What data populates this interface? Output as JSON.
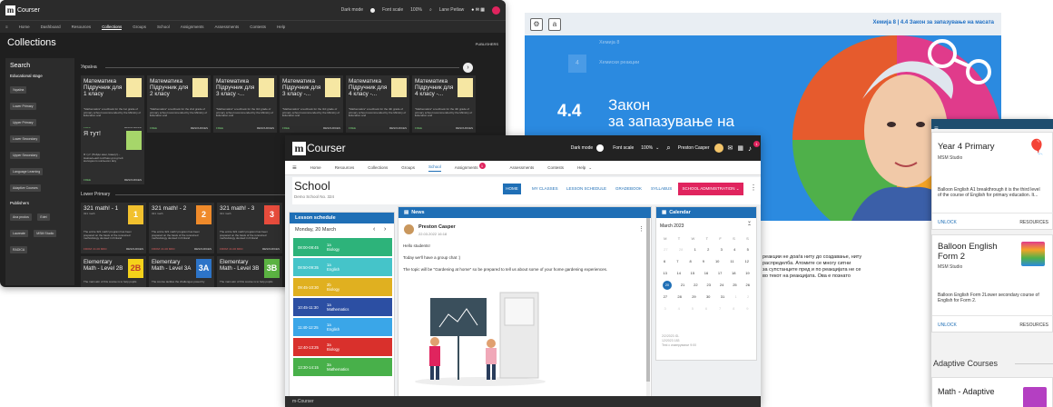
{
  "dark": {
    "brand": "Courser",
    "top_right": [
      "Dark mode",
      "Font scale",
      "100%",
      "Lane Petlaw"
    ],
    "nav": [
      "Home",
      "Dashboard",
      "Resources",
      "Collections",
      "Groups",
      "School",
      "Assignments",
      "Assessments",
      "Contests",
      "Help"
    ],
    "page_title": "Collections",
    "publishers_btn": "PUBLISHERS",
    "search_title": "Search",
    "edu_stage_label": "Educational stage",
    "edu_chips": [
      "Україна",
      "Lower Primary",
      "Upper Primary",
      "Lower Secondary",
      "Upper Secondary",
      "Language Learning",
      "Adaptive Courses"
    ],
    "publishers_label": "Publishers",
    "pub_chips": [
      "Ana prodos",
      "Edet",
      "Laureate",
      "MSM Studio",
      "RADICA"
    ],
    "section_ukraine": "Україна",
    "ukraine_cards": [
      {
        "title": "Математика Підручник для 1 класу",
        "desc": "\"Mathematics\" a textbook for the 1st grade of primary school recommended by the Ministry of Education and",
        "free": "FREE",
        "res": "RESOURCES"
      },
      {
        "title": "Математика Підручник для 2 класу",
        "desc": "\"Mathematics\" a textbook for the 2nd grade of primary school recommended by the Ministry of Education and",
        "free": "FREE",
        "res": "RESOURCES"
      },
      {
        "title": "Математика Підручник для 3 класу -...",
        "desc": "\"Mathematics\" a textbook for the 3rd grade of primary school recommended by the Ministry of Education and",
        "free": "FREE",
        "res": "RESOURCES"
      },
      {
        "title": "Математика Підручник для 3 класу -...",
        "desc": "\"Mathematics\" a textbook for the 3rd grade of primary school recommended by the Ministry of Education and",
        "free": "FREE",
        "res": "RESOURCES"
      },
      {
        "title": "Математика Підручник для 4 класу -...",
        "desc": "\"Mathematics\" a textbook for the 4th grade of primary school recommended by the Ministry of Education and",
        "free": "FREE",
        "res": "RESOURCES"
      },
      {
        "title": "Математика Підручник для 4 класу -...",
        "desc": "\"Mathematics\" a textbook for the 4th grade of primary school recommended by the Ministry of Education and",
        "free": "FREE",
        "res": "RESOURCES"
      }
    ],
    "ukraine_small": {
      "title": "Я тут!",
      "desc": "Я тут! (Пойди мені, Іванку!) – Навчальний посібник для дітей молодшого шкільного віку",
      "free": "FREE",
      "res": "RESOURCES"
    },
    "section_lower": "Lower Primary",
    "lower_cards": [
      {
        "title": "321 math! - 1",
        "sub": "321 math",
        "desc": "The entire 321 math! program has been prepared on the basis of the renowned methodology devised in Finland",
        "price": "FROM: 21.00 MKD",
        "res": "RESOURCES",
        "badge": "1"
      },
      {
        "title": "321 math! - 2",
        "sub": "321 math",
        "desc": "The entire 321 math! program has been prepared on the basis of the renowned methodology devised in Finland",
        "price": "FROM: 21.00 MKD",
        "res": "RESOURCES",
        "badge": "2"
      },
      {
        "title": "321 math! - 3",
        "sub": "321 math",
        "desc": "The entire 321 math! program has been prepared on the basis of the renowned methodology devised in Finland",
        "price": "FROM: 21.00 MKD",
        "res": "RESOURCES",
        "badge": "3"
      },
      {
        "title": "Elementary Math - Level 2B",
        "sub": "",
        "desc": "The main aim of this course is to help pupils",
        "price": "",
        "res": "",
        "badge": "2B"
      },
      {
        "title": "Elementary Math - Level 3A",
        "sub": "",
        "desc": "The course tackles the challenges posed by",
        "price": "",
        "res": "",
        "badge": "3A"
      },
      {
        "title": "Elementary Math - Level 3B",
        "sub": "",
        "desc": "The main aim of this course is to help pupils",
        "price": "",
        "res": "",
        "badge": "3B"
      }
    ]
  },
  "blue": {
    "breadcrumb": "Хемија 8 | 4.4 Закон за запазување на масата",
    "chapter": "Хемија 8",
    "section": "Хемиски реакции",
    "section_num": "4",
    "lesson_num": "4.4",
    "lesson_title_1": "Закон",
    "lesson_title_2": "за запазување на",
    "body_lines": [
      "реакции не доаѓа ниту до создавање, ниту",
      "распределба. Атомите се многу ситни",
      "за супстанците пред и по реакцијата не се",
      "во текот на реакцијата. Ова е познато"
    ]
  },
  "side": {
    "card1_title": "Year 4 Primary",
    "card1_pub": "MSM Studio",
    "card1_desc": "Balloon English A1 breakthrough it is the third level of the course of English for primary education. It...",
    "card1_unlock": "UNLOCK",
    "card1_res": "RESOURCES",
    "card2_title": "Balloon English Form 2",
    "card2_pub": "MSM Studio",
    "card2_desc": "Balloon English Form 2Lower secondary course of English for Form 2.",
    "card2_unlock": "UNLOCK",
    "card2_res": "RESOURCES",
    "adaptive": "Adaptive Courses",
    "card3_title": "Math - Adaptive"
  },
  "main": {
    "brand": "Courser",
    "dark_mode": "Dark mode",
    "font_scale": "Font scale",
    "zoom": "100%",
    "user": "Preston Casper",
    "notif_count": "1",
    "assign_count": "1",
    "nav": [
      "Home",
      "Resources",
      "Collections",
      "Groups",
      "School",
      "Assignments",
      "Assessments",
      "Contests",
      "Help"
    ],
    "school_title": "School",
    "school_sub": "Demo School No. 324",
    "tabs": [
      "HOME",
      "MY CLASSES",
      "LESSON SCHEDULE",
      "GRADEBOOK",
      "SYLLABUS"
    ],
    "admin_btn": "SCHOOL ADMINISTRATION",
    "schedule_title": "Lesson schedule",
    "schedule_date": "Monday, 20 March",
    "lessons": [
      {
        "time": "08:00-08:45",
        "grade": "1a",
        "subject": "Biology",
        "color": "#2db37a"
      },
      {
        "time": "08:50-09:35",
        "grade": "1a",
        "subject": "English",
        "color": "#45c4c9"
      },
      {
        "time": "09:45-10:30",
        "grade": "2b",
        "subject": "Biology",
        "color": "#e0b020"
      },
      {
        "time": "10:45-11:30",
        "grade": "1a",
        "subject": "Mathematics",
        "color": "#2c4fa3"
      },
      {
        "time": "11:40-12:25",
        "grade": "1a",
        "subject": "English",
        "color": "#3aa6e8"
      },
      {
        "time": "12:40-13:25",
        "grade": "3a",
        "subject": "Biology",
        "color": "#d9302c"
      },
      {
        "time": "13:30-14:15",
        "grade": "3a",
        "subject": "Mathematics",
        "color": "#48b04a"
      }
    ],
    "news_title": "News",
    "news_author": "Preston Casper",
    "news_date": "22.03.2022 16:18",
    "news_l1": "Hello students!",
    "news_l2": "Today we'll have a group chat :)",
    "news_l3": "The topic will be \"Gardening at home\" so be prepared to tell us about some of your home gardening experiences.",
    "cal_title": "Calendar",
    "cal_month": "March 2023",
    "cal_head": [
      "M",
      "T",
      "W",
      "T",
      "F",
      "S",
      "S"
    ],
    "cal_rows": [
      [
        "27",
        "28",
        "1",
        "2",
        "3",
        "4",
        "5"
      ],
      [
        "6",
        "7",
        "8",
        "9",
        "10",
        "11",
        "12"
      ],
      [
        "13",
        "14",
        "15",
        "16",
        "17",
        "18",
        "19"
      ],
      [
        "20",
        "21",
        "22",
        "23",
        "24",
        "25",
        "26"
      ],
      [
        "27",
        "28",
        "29",
        "30",
        "31",
        "1",
        "2"
      ],
      [
        "3",
        "4",
        "5",
        "6",
        "7",
        "8",
        "9"
      ]
    ],
    "cal_event_1": "2/2/2023 ID-",
    "cal_event_2": "12/2023 183",
    "cal_event_3": "Test с измерување 9:00",
    "footer": "m-Courser"
  }
}
